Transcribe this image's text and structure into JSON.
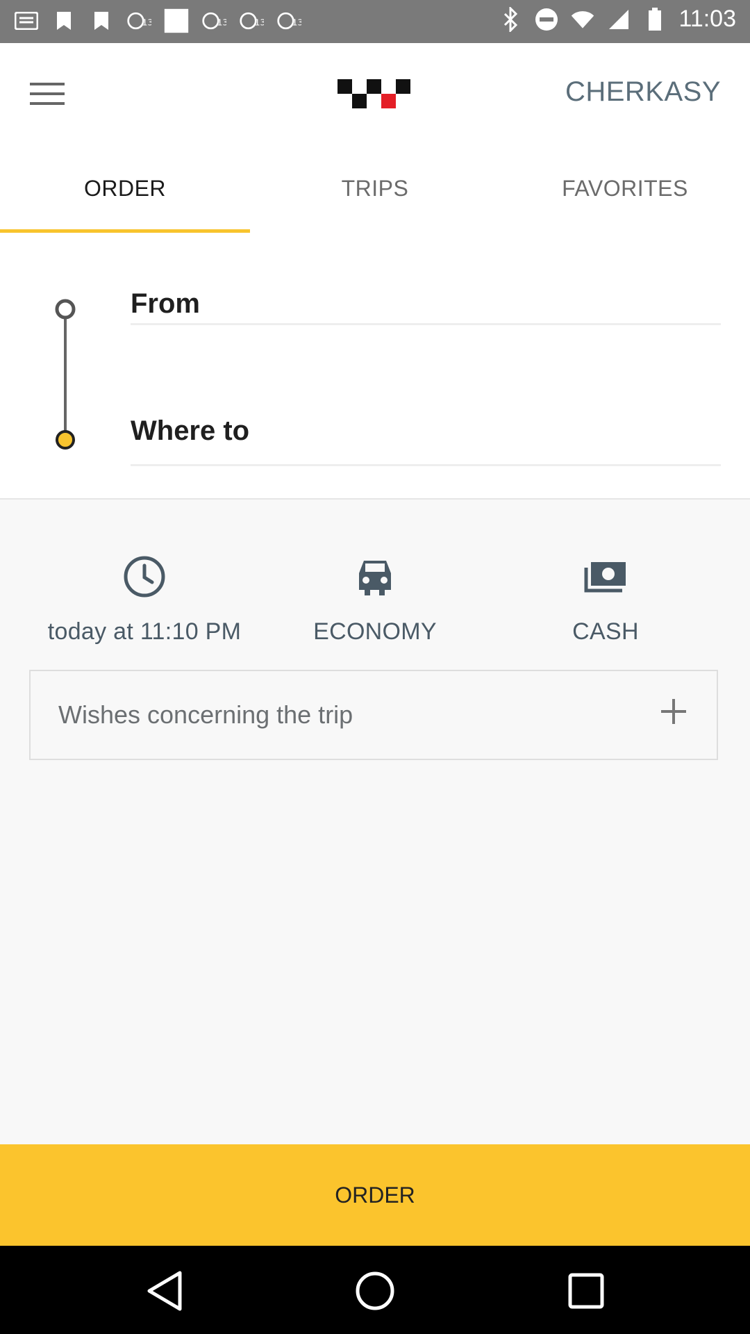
{
  "status_bar": {
    "time": "11:03",
    "left_icons": [
      "message-icon",
      "bookmark-icon",
      "bookmark-icon",
      "abc13-icon",
      "image-icon",
      "abc13-icon",
      "abc13-icon",
      "abc13-icon"
    ],
    "right_icons": [
      "bluetooth-icon",
      "do-not-disturb-icon",
      "wifi-icon",
      "signal-icon",
      "battery-icon"
    ]
  },
  "app_bar": {
    "city": "CHERKASY",
    "logo": "taxi-checker-logo"
  },
  "tabs": [
    {
      "label": "ORDER",
      "active": true
    },
    {
      "label": "TRIPS",
      "active": false
    },
    {
      "label": "FAVORITES",
      "active": false
    }
  ],
  "route": {
    "from_label": "From",
    "to_label": "Where to"
  },
  "options": {
    "time": {
      "icon": "clock-icon",
      "label": "today at 11:10 PM"
    },
    "class": {
      "icon": "car-icon",
      "label": "ECONOMY"
    },
    "payment": {
      "icon": "cash-icon",
      "label": "CASH"
    }
  },
  "wishes": {
    "label": "Wishes concerning the trip",
    "action_icon": "plus-icon"
  },
  "order_button": {
    "label": "ORDER"
  },
  "colors": {
    "accent": "#fbc42d",
    "icon_tint": "#4a5a66"
  }
}
